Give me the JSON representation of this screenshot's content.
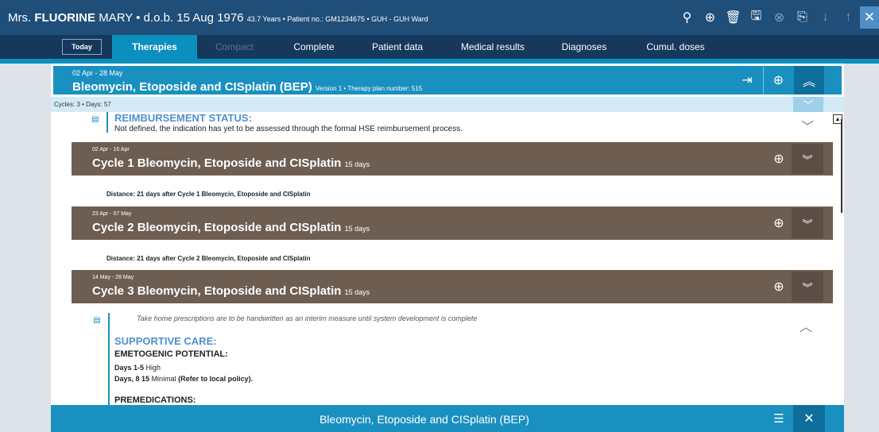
{
  "patient": {
    "title": "Mrs.",
    "surname": "FLUORINE",
    "given": "MARY",
    "dob": "• d.o.b. 15 Aug 1976",
    "details": "43.7 Years • Patient no.: GM1234675 • GUH - GUH Ward"
  },
  "header_icons": {
    "search": "⚲",
    "add": "⊕",
    "delete": "🗑",
    "save": "🖫",
    "cancel": "⊗",
    "export": "⎘",
    "down": "↓",
    "up": "↑",
    "close": "✕"
  },
  "nav": {
    "today": "Today",
    "tabs": [
      "Therapies",
      "Compact",
      "Complete",
      "Patient data",
      "Medical results",
      "Diagnoses",
      "Cumul. doses"
    ]
  },
  "plan": {
    "dates": "02 Apr - 28 May",
    "title": "Bleomycin, Etoposide and CISplatin (BEP)",
    "subtitle": "Version 1 • Therapy plan number: 515",
    "cycles_summary": "Cycles: 3 • Days: 57"
  },
  "reimbursement": {
    "title": "REIMBURSEMENT STATUS:",
    "text": "Not defined, the indication has yet to be assessed through the formal HSE reimbursement process."
  },
  "cycles": [
    {
      "dates": "02 Apr - 16 Apr",
      "title": "Cycle 1 Bleomycin, Etoposide and CISplatin",
      "days": "15 days"
    },
    {
      "dates": "23 Apr - 07 May",
      "title": "Cycle 2 Bleomycin, Etoposide and CISplatin",
      "days": "15 days"
    },
    {
      "dates": "14 May - 28 May",
      "title": "Cycle 3 Bleomycin, Etoposide and CISplatin",
      "days": "15 days"
    }
  ],
  "distances": [
    "Distance: 21 days after Cycle 1 Bleomycin, Etoposide and CISplatin",
    "Distance: 21 days after Cycle 2 Bleomycin, Etoposide and CISplatin"
  ],
  "notes": {
    "take_home": "Take home prescriptions are to be handwritten as an interim measure until system development is complete",
    "supportive_care": "SUPPORTIVE CARE:",
    "emetogenic": "EMETOGENIC POTENTIAL:",
    "days1_label": "Days 1-5",
    "days1_value": "High",
    "days2_label": "Days, 8 15",
    "days2_value": "Minimal",
    "days2_extra": "(Refer to local policy).",
    "premedications": "PREMEDICATIONS:"
  },
  "footer": {
    "title": "Bleomycin, Etoposide and CISplatin (BEP)"
  },
  "colors": {
    "header": "#1f4e79",
    "nav": "#16385c",
    "accent": "#1a90c0",
    "cycle": "#6e5e52"
  }
}
